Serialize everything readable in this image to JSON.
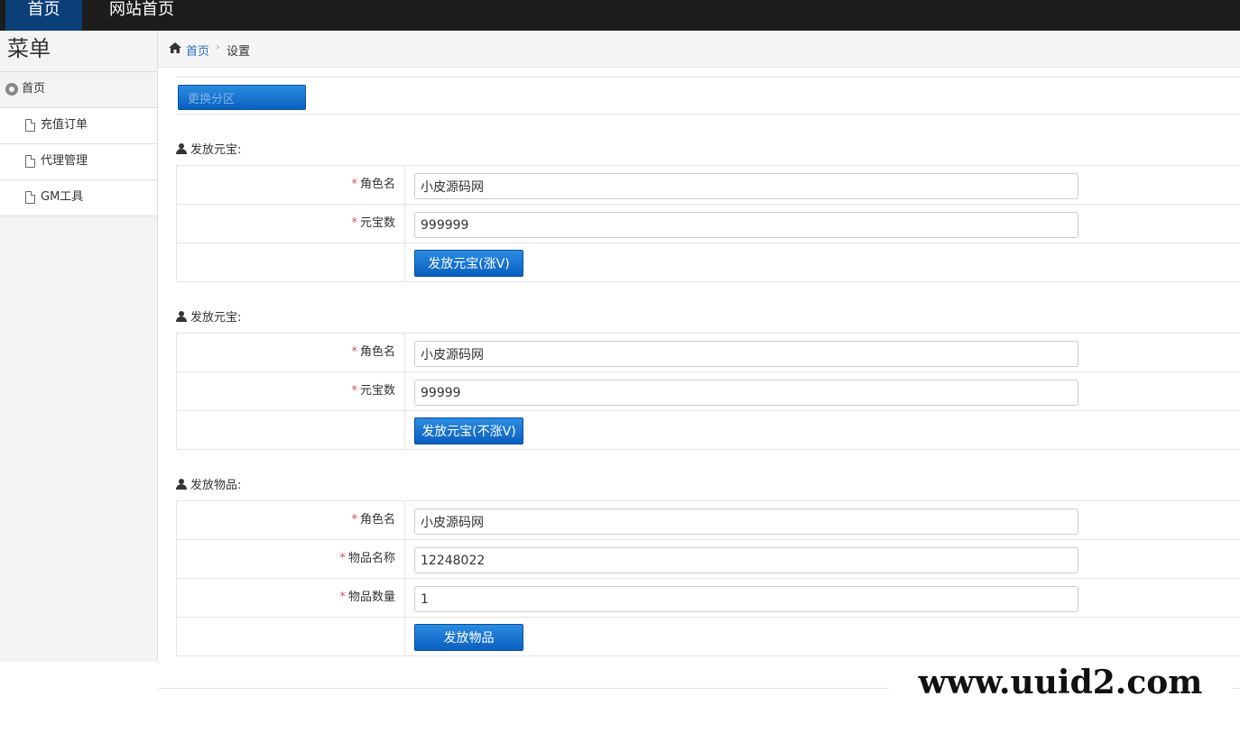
{
  "topbar": {
    "tabs": [
      {
        "label": "首页"
      },
      {
        "label": "网站首页"
      }
    ]
  },
  "sidebar": {
    "title": "菜单",
    "items": [
      {
        "label": "首页",
        "icon": "gear-icon"
      },
      {
        "label": "充值订单",
        "icon": "document-icon"
      },
      {
        "label": "代理管理",
        "icon": "document-icon"
      },
      {
        "label": "GM工具",
        "icon": "document-icon"
      }
    ]
  },
  "breadcrumb": {
    "home": "首页",
    "separator": "›",
    "current": "设置"
  },
  "toolbar": {
    "switch_label": "更换分区"
  },
  "sections": [
    {
      "title": "发放元宝:",
      "fields": [
        {
          "label": "角色名",
          "value": "小皮源码网"
        },
        {
          "label": "元宝数",
          "value": "999999"
        }
      ],
      "button": "发放元宝(涨V)"
    },
    {
      "title": "发放元宝:",
      "fields": [
        {
          "label": "角色名",
          "value": "小皮源码网"
        },
        {
          "label": "元宝数",
          "value": "99999"
        }
      ],
      "button": "发放元宝(不涨V)"
    },
    {
      "title": "发放物品:",
      "fields": [
        {
          "label": "角色名",
          "value": "小皮源码网"
        },
        {
          "label": "物品名称",
          "value": "12248022"
        },
        {
          "label": "物品数量",
          "value": "1"
        }
      ],
      "button": "发放物品"
    }
  ],
  "required_mark": "*",
  "watermark": "www.uuid2.com",
  "colors": {
    "topbar": "#1c1c1c",
    "active_tab": "#0a3f78",
    "button": "#0a5fc0",
    "link": "#2a6fba",
    "required": "#d9534f"
  }
}
